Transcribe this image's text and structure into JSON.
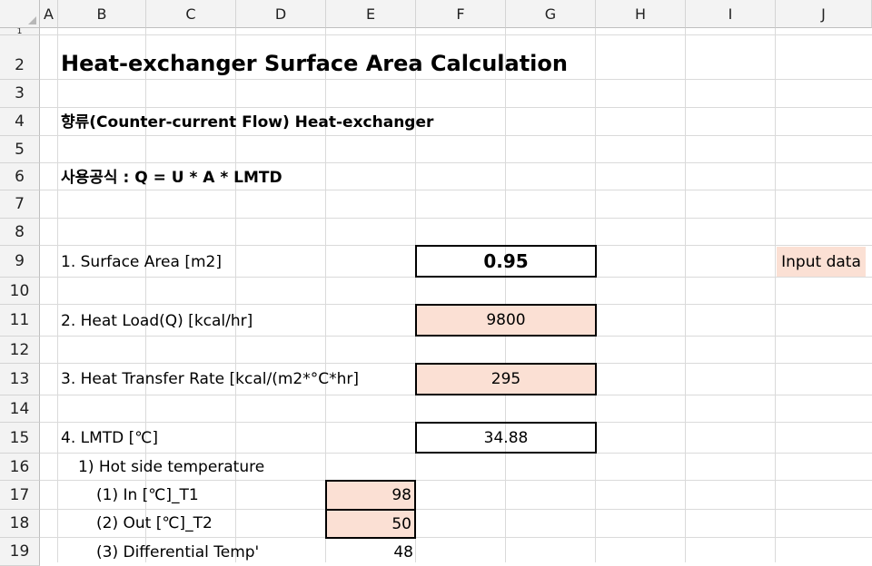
{
  "columns": [
    "A",
    "B",
    "C",
    "D",
    "E",
    "F",
    "G",
    "H",
    "I",
    "J"
  ],
  "rows": [
    "1",
    "2",
    "3",
    "4",
    "5",
    "6",
    "7",
    "8",
    "9",
    "10",
    "11",
    "12",
    "13",
    "14",
    "15",
    "16",
    "17",
    "18",
    "19"
  ],
  "sheet": {
    "title": "Heat-exchanger Surface Area Calculation",
    "subtitle": "향류(Counter-current Flow) Heat-exchanger",
    "formula": "사용공식 :  Q = U * A * LMTD",
    "surface_area_label": "1. Surface Area [m2]",
    "surface_area_value": "0.95",
    "input_note": "Input data",
    "heat_load_label": "2. Heat Load(Q) [kcal/hr]",
    "heat_load_value": "9800",
    "htr_label": "3. Heat Transfer Rate [kcal/(m2*°C*hr]",
    "htr_value": "295",
    "lmtd_label": "4. LMTD [℃]",
    "lmtd_value": "34.88",
    "hot_side_label": "1) Hot side temperature",
    "hot_in_label": "(1) In [℃]_T1",
    "hot_in_value": "98",
    "hot_out_label": "(2) Out [℃]_T2",
    "hot_out_value": "50",
    "diff_label": "(3) Differential Temp'",
    "diff_value": "48"
  },
  "colors": {
    "input_fill": "#fbe0d4",
    "header_bg": "#f3f3f3",
    "gridline": "#dadada"
  }
}
